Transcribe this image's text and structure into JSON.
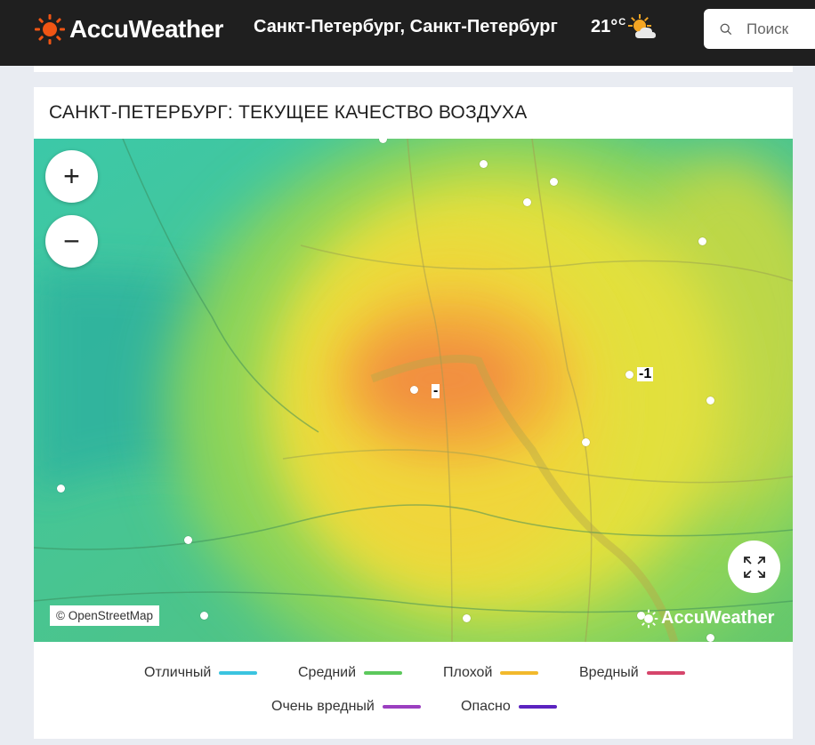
{
  "header": {
    "logo_text": "AccuWeather",
    "location": "Санкт-Петербург, Санкт-Петербург",
    "temperature": "21°",
    "temperature_unit": "C",
    "weather_icon": "partly-sunny-icon",
    "search_placeholder": "Поиск"
  },
  "card": {
    "title": "САНКТ-ПЕТЕРБУРГ: ТЕКУЩЕЕ КАЧЕСТВО ВОЗДУХА"
  },
  "map": {
    "zoom_in_label": "+",
    "zoom_out_label": "−",
    "attribution": "© OpenStreetMap",
    "watermark": "AccuWeather",
    "station_labels": [
      "-",
      "-1"
    ]
  },
  "legend": {
    "items": [
      {
        "label": "Отличный",
        "color": "#3bc4e0"
      },
      {
        "label": "Средний",
        "color": "#5cc85c"
      },
      {
        "label": "Плохой",
        "color": "#f2b92c"
      },
      {
        "label": "Вредный",
        "color": "#d6456b"
      },
      {
        "label": "Очень вредный",
        "color": "#9b3fc0"
      },
      {
        "label": "Опасно",
        "color": "#5b23c0"
      }
    ]
  },
  "colors": {
    "header_bg": "#1f1f1f",
    "brand_orange": "#f05514"
  }
}
